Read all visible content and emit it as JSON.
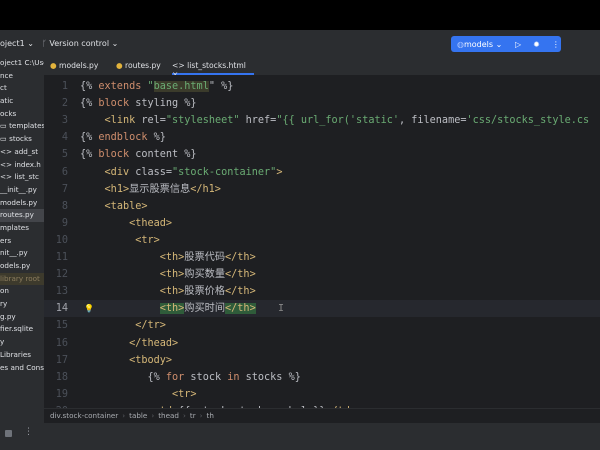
{
  "toolbar": {
    "project": "oject1 ⌄",
    "vc_icon": "branch-icon",
    "version_control": "Version control ⌄",
    "run_config": "models ⌄",
    "run_icon": "play-icon",
    "debug_icon": "bug-icon",
    "more_icon": "more-vertical-icon",
    "accent": "#3574f0"
  },
  "sidebar": {
    "items": [
      {
        "label": "oject1  C:\\Use"
      },
      {
        "label": "nce"
      },
      {
        "label": "ct"
      },
      {
        "label": "atic"
      },
      {
        "label": "ocks"
      },
      {
        "label": "▭ templates"
      },
      {
        "label": "  ▭ stocks"
      },
      {
        "label": "     <> add_st"
      },
      {
        "label": "     <> index.h"
      },
      {
        "label": "     <> list_stc"
      },
      {
        "label": "  __init__.py"
      },
      {
        "label": "  models.py"
      },
      {
        "label": "  routes.py"
      },
      {
        "label": "mplates"
      },
      {
        "label": "ers"
      },
      {
        "label": "nit__.py"
      },
      {
        "label": "odels.py"
      },
      {
        "label": "  library root"
      },
      {
        "label": "on"
      },
      {
        "label": "ry"
      },
      {
        "label": "g.py"
      },
      {
        "label": "fier.sqlite"
      },
      {
        "label": "y"
      },
      {
        "label": " Libraries"
      },
      {
        "label": "es and Consol"
      }
    ]
  },
  "tabs": [
    {
      "label": "models.py"
    },
    {
      "label": "routes.py"
    },
    {
      "label": "<> list_stocks.html ×"
    }
  ],
  "code": [
    [
      [
        "{% ",
        "d"
      ],
      [
        "extends ",
        "k"
      ],
      [
        "\"",
        "s"
      ],
      [
        "base.html",
        "hl"
      ],
      [
        "\" %}",
        "d"
      ]
    ],
    [
      [
        "{% ",
        "d"
      ],
      [
        "block ",
        "k"
      ],
      [
        "styling %}",
        "d"
      ]
    ],
    [
      [
        "    ",
        "d"
      ],
      [
        "<link ",
        "tag"
      ],
      [
        "rel=",
        "attr"
      ],
      [
        "\"stylesheet\" ",
        "str"
      ],
      [
        "href=",
        "attr"
      ],
      [
        "\"{{ url_for(",
        "str"
      ],
      [
        "'static'",
        "s"
      ],
      [
        ", filename=",
        "d"
      ],
      [
        "'css/stocks_style.cs",
        "s"
      ]
    ],
    [
      [
        "{% ",
        "d"
      ],
      [
        "endblock ",
        "k"
      ],
      [
        "%}",
        "d"
      ]
    ],
    [
      [
        "{% ",
        "d"
      ],
      [
        "block ",
        "k"
      ],
      [
        "content %}",
        "d"
      ]
    ],
    [
      [
        "    ",
        "d"
      ],
      [
        "<div ",
        "tag"
      ],
      [
        "class=",
        "attr"
      ],
      [
        "\"stock-container\"",
        "str"
      ],
      [
        ">",
        "tag"
      ]
    ],
    [
      [
        "    ",
        "d"
      ],
      [
        "<h1>",
        "tag"
      ],
      [
        "显示股票信息",
        "cn"
      ],
      [
        "</h1>",
        "tag"
      ]
    ],
    [
      [
        "    ",
        "d"
      ],
      [
        "<table>",
        "tag"
      ]
    ],
    [
      [
        "        ",
        "d"
      ],
      [
        "<thead>",
        "tag"
      ]
    ],
    [
      [
        "         ",
        "d"
      ],
      [
        "<tr>",
        "tag"
      ]
    ],
    [
      [
        "             ",
        "d"
      ],
      [
        "<th>",
        "tag"
      ],
      [
        "股票代码",
        "cn"
      ],
      [
        "</th>",
        "tag"
      ]
    ],
    [
      [
        "             ",
        "d"
      ],
      [
        "<th>",
        "tag"
      ],
      [
        "购买数量",
        "cn"
      ],
      [
        "</th>",
        "tag"
      ]
    ],
    [
      [
        "             ",
        "d"
      ],
      [
        "<th>",
        "tag"
      ],
      [
        "股票价格",
        "cn"
      ],
      [
        "</th>",
        "tag"
      ]
    ],
    [
      [
        "             ",
        "d"
      ],
      [
        "<th>",
        "gm"
      ],
      [
        "购买时间",
        "cn"
      ],
      [
        "</th>",
        "gm"
      ]
    ],
    [
      [
        "         ",
        "d"
      ],
      [
        "</tr>",
        "tag"
      ]
    ],
    [
      [
        "        ",
        "d"
      ],
      [
        "</thead>",
        "tag"
      ]
    ],
    [
      [
        "        ",
        "d"
      ],
      [
        "<tbody>",
        "tag"
      ]
    ],
    [
      [
        "           ",
        "d"
      ],
      [
        "{% ",
        "d"
      ],
      [
        "for ",
        "k"
      ],
      [
        "stock ",
        "d"
      ],
      [
        "in ",
        "k"
      ],
      [
        "stocks %}",
        "d"
      ]
    ],
    [
      [
        "               ",
        "d"
      ],
      [
        "<tr>",
        "tag"
      ]
    ],
    [
      [
        "            ",
        "d"
      ],
      [
        "<td>",
        "tag"
      ],
      [
        "{{ stock.stock_symbol }}",
        "d"
      ],
      [
        "</td>",
        "tag"
      ]
    ]
  ],
  "breadcrumb": [
    "div.stock-container",
    "table",
    "thead",
    "tr",
    "th"
  ]
}
